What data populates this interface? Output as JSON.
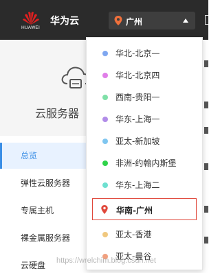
{
  "header": {
    "logo_text": "HUAWEI",
    "brand": "华为云",
    "region": {
      "selected_label": "广州",
      "icon": "map-pin-icon",
      "caret_icon": "caret-up-icon"
    }
  },
  "sidebar": {
    "icon": "cloud-server-icon",
    "title": "云服务器",
    "items": [
      {
        "label": "总览",
        "active": true
      },
      {
        "label": "弹性云服务器"
      },
      {
        "label": "专属主机"
      },
      {
        "label": "裸金属服务器"
      },
      {
        "label": "云硬盘"
      }
    ]
  },
  "region_dropdown": {
    "items": [
      {
        "label": "华北-北京一",
        "color": "#7fa7f0"
      },
      {
        "label": "华北-北京四",
        "color": "#e07ee8"
      },
      {
        "label": "西南-贵阳一",
        "color": "#7fe0a8"
      },
      {
        "label": "华东-上海一",
        "color": "#b18ce8"
      },
      {
        "label": "亚太-新加坡",
        "color": "#7fc6f0"
      },
      {
        "label": "非洲-约翰内斯堡",
        "color": "#2fd34a"
      },
      {
        "label": "华东-上海二",
        "color": "#6ee0d0"
      },
      {
        "label": "华南-广州",
        "color": "#e0483b",
        "selected": true,
        "icon": "map-pin-icon"
      },
      {
        "label": "亚太-香港",
        "color": "#f0c87f"
      },
      {
        "label": "亚太-曼谷",
        "color": "#f0a07f"
      }
    ]
  },
  "watermark": "https://wrelchim.blog.csdn.net"
}
